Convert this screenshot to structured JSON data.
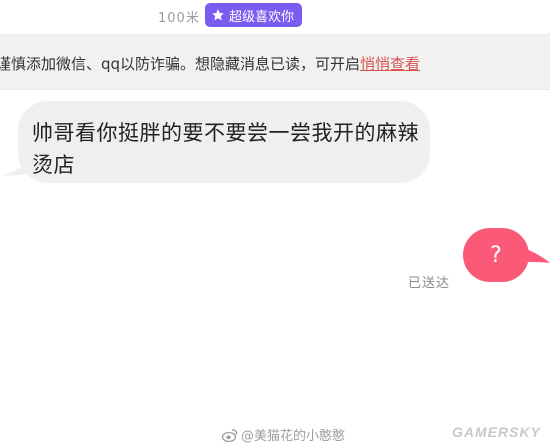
{
  "header": {
    "distance": "100米",
    "badge_label": "超级喜欢你",
    "badge_icon": "star-icon"
  },
  "notice": {
    "text": "谨慎添加微信、qq以防诈骗。想隐藏消息已读，可开启",
    "link_label": "悄悄查看"
  },
  "messages": {
    "incoming_text": "帅哥看你挺胖的要不要尝一尝我开的麻辣烫店",
    "outgoing_text": "?",
    "status": "已送达"
  },
  "watermark": {
    "account": "@美猫花的小憨憨",
    "brand": "GAMERSKY",
    "icon": "weibo-icon"
  },
  "colors": {
    "badge": "#7b5cf0",
    "link": "#d9534f",
    "incoming_bubble": "#efefef",
    "outgoing_bubble": "#fa5a77"
  }
}
